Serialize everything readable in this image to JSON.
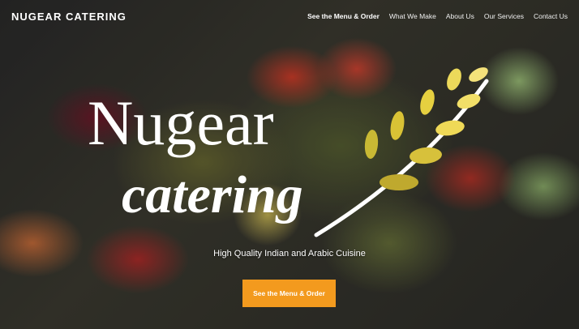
{
  "header": {
    "brand": "NUGEAR CATERING"
  },
  "nav": {
    "items": [
      {
        "label": "See the Menu & Order",
        "active": true
      },
      {
        "label": "What We Make"
      },
      {
        "label": "About Us"
      },
      {
        "label": "Our Services"
      },
      {
        "label": "Contact Us"
      }
    ]
  },
  "hero": {
    "logo_line1": "Nugear",
    "logo_line2": "catering",
    "tagline": "High Quality Indian and Arabic Cuisine",
    "cta_label": "See the Menu & Order"
  },
  "colors": {
    "accent": "#f39a1e",
    "leaf_light": "#f4e27a",
    "leaf_dark": "#c9b934"
  }
}
